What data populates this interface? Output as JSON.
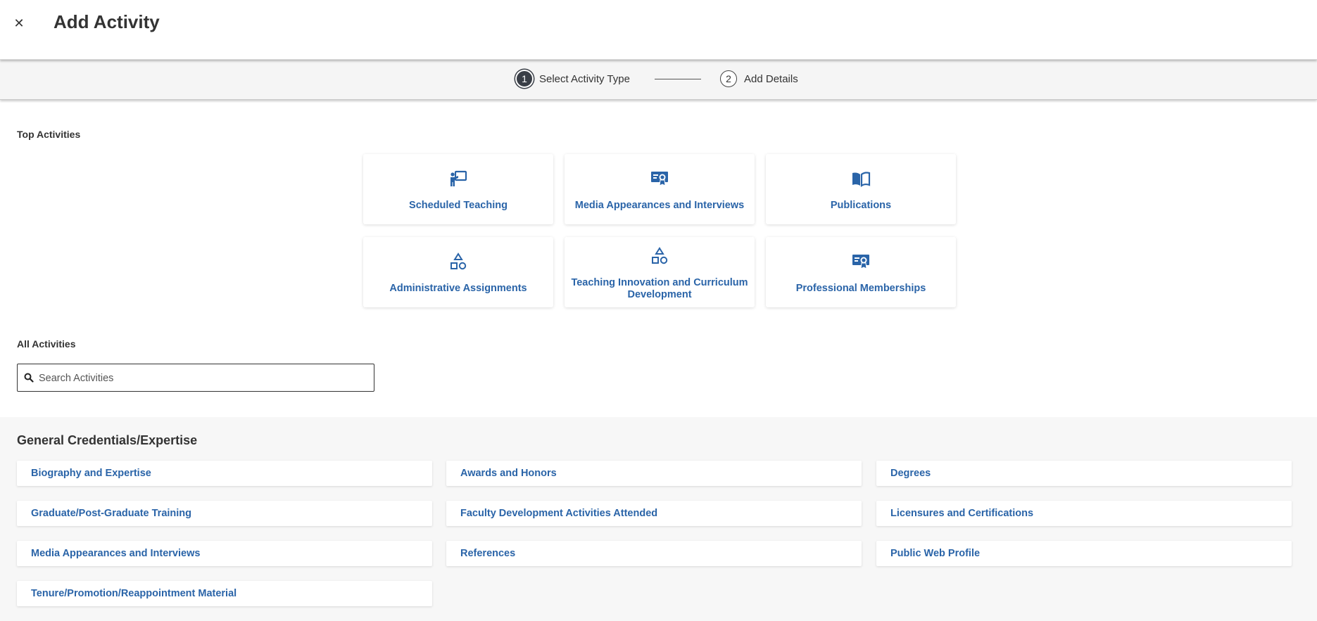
{
  "header": {
    "title": "Add Activity",
    "close_icon": "close-icon"
  },
  "stepper": {
    "steps": [
      {
        "number": "1",
        "label": "Select Activity Type",
        "active": true
      },
      {
        "number": "2",
        "label": "Add Details",
        "active": false
      }
    ]
  },
  "top_activities": {
    "label": "Top Activities",
    "cards": [
      {
        "label": "Scheduled Teaching",
        "icon": "teaching-icon"
      },
      {
        "label": "Media Appearances and Interviews",
        "icon": "certificate-icon"
      },
      {
        "label": "Publications",
        "icon": "open-book-icon"
      },
      {
        "label": "Administrative Assignments",
        "icon": "shapes-icon"
      },
      {
        "label": "Teaching Innovation and Curriculum Development",
        "icon": "shapes-icon"
      },
      {
        "label": "Professional Memberships",
        "icon": "certificate-icon"
      }
    ]
  },
  "all_activities": {
    "label": "All Activities",
    "search_placeholder": "Search Activities",
    "search_icon": "search-icon"
  },
  "groups": [
    {
      "title": "General Credentials/Expertise",
      "items": [
        "Biography and Expertise",
        "Awards and Honors",
        "Degrees",
        "Graduate/Post-Graduate Training",
        "Faculty Development Activities Attended",
        "Licensures and Certifications",
        "Media Appearances and Interviews",
        "References",
        "Public Web Profile",
        "Tenure/Promotion/Reappointment Material"
      ]
    }
  ],
  "colors": {
    "link": "#2a64a8",
    "step_active": "#3a3f47",
    "gray_bg": "#f7f7f7"
  }
}
